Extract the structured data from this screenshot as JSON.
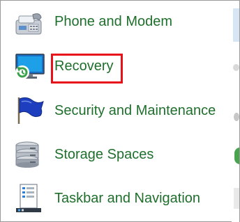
{
  "control_panel": {
    "items": [
      {
        "label": "Phone and Modem",
        "icon": "phone-modem-icon"
      },
      {
        "label": "Recovery",
        "icon": "recovery-icon"
      },
      {
        "label": "Security and Maintenance",
        "icon": "security-flag-icon"
      },
      {
        "label": "Storage Spaces",
        "icon": "storage-spaces-icon"
      },
      {
        "label": "Taskbar and Navigation",
        "icon": "taskbar-navigation-icon"
      }
    ]
  },
  "colors": {
    "link_text": "#1f6f2c",
    "highlight_border": "#e8111a"
  }
}
